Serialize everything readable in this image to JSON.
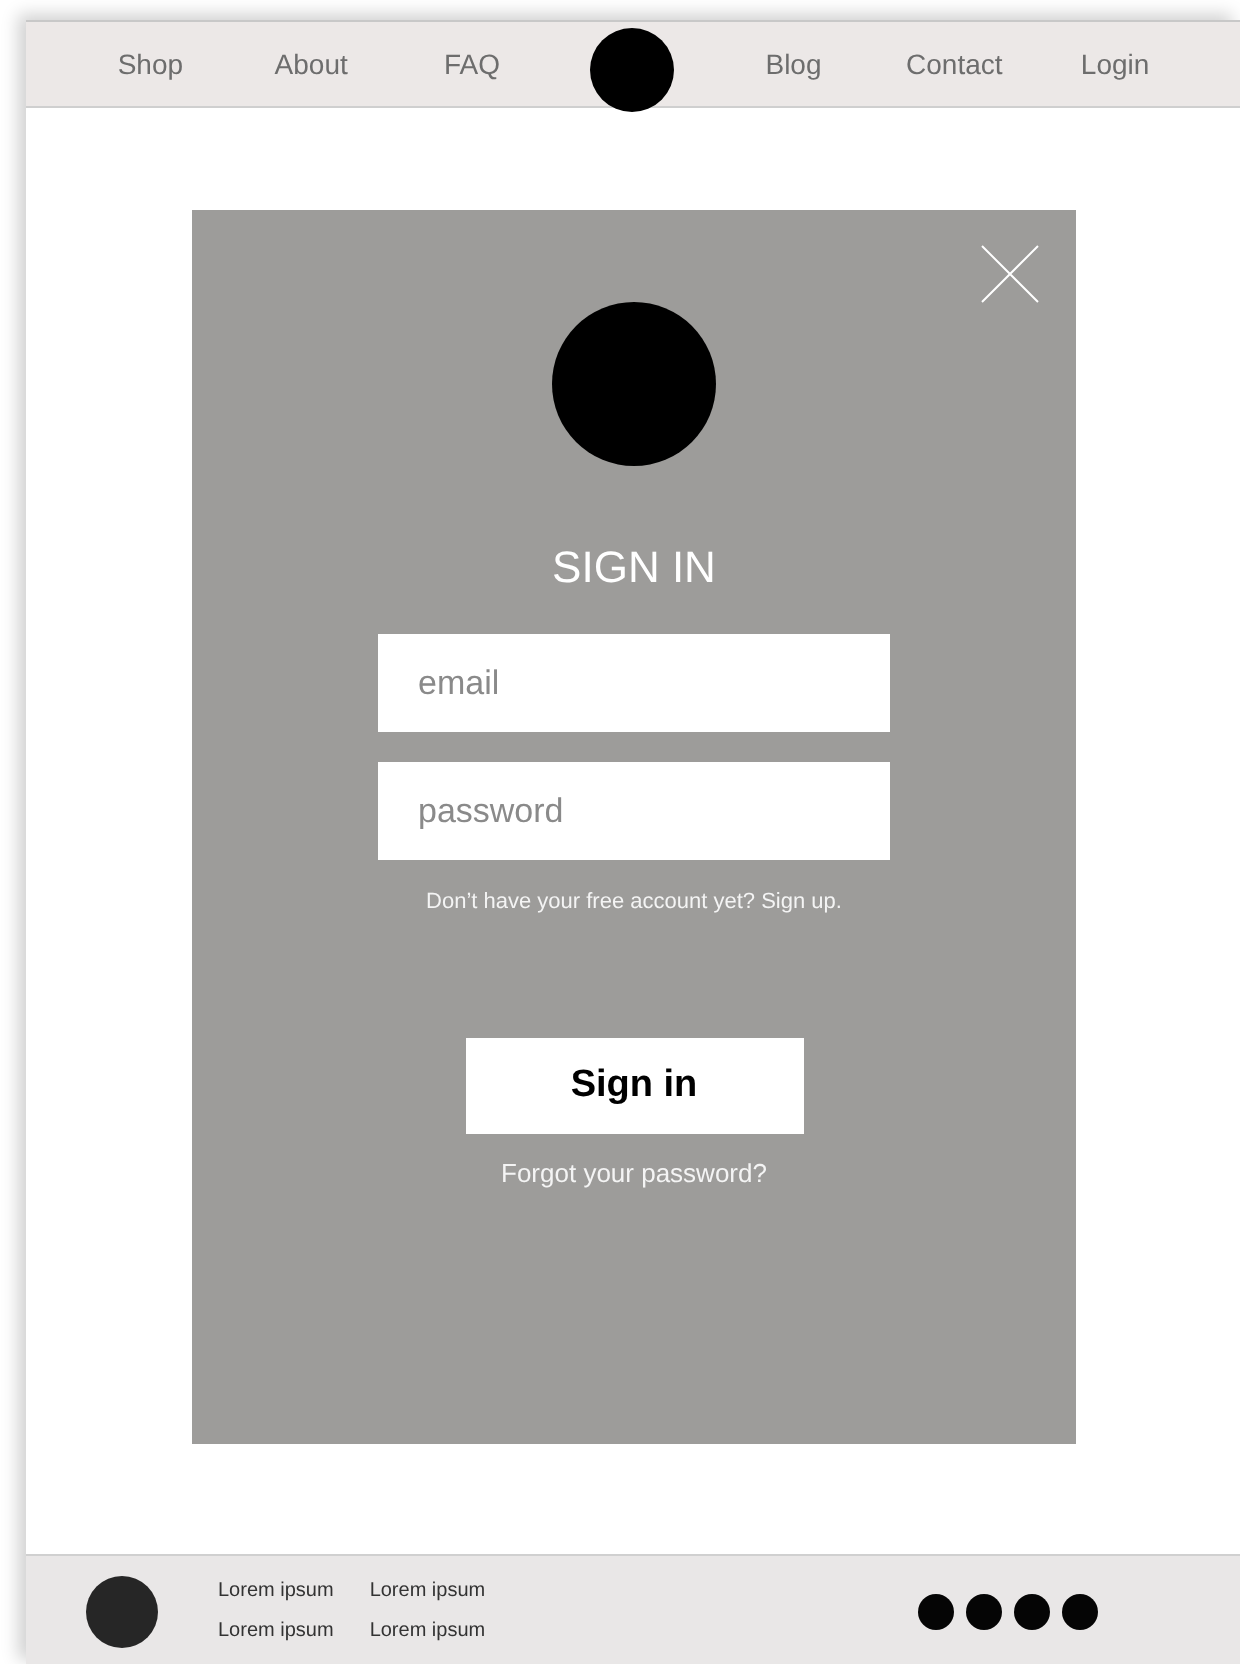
{
  "nav": {
    "left": [
      "Shop",
      "About",
      "FAQ"
    ],
    "right": [
      "Blog",
      "Contact",
      "Login"
    ]
  },
  "modal": {
    "title": "SIGN IN",
    "email": {
      "placeholder": "email"
    },
    "password": {
      "placeholder": "password"
    },
    "signup_prompt": "Don’t have your free account yet?",
    "signup_link": "Sign up.",
    "button": "Sign in",
    "forgot": "Forgot your password?"
  },
  "footer": {
    "columns": [
      [
        "Lorem ipsum",
        "Lorem ipsum"
      ],
      [
        "Lorem ipsum",
        "Lorem ipsum"
      ]
    ]
  }
}
